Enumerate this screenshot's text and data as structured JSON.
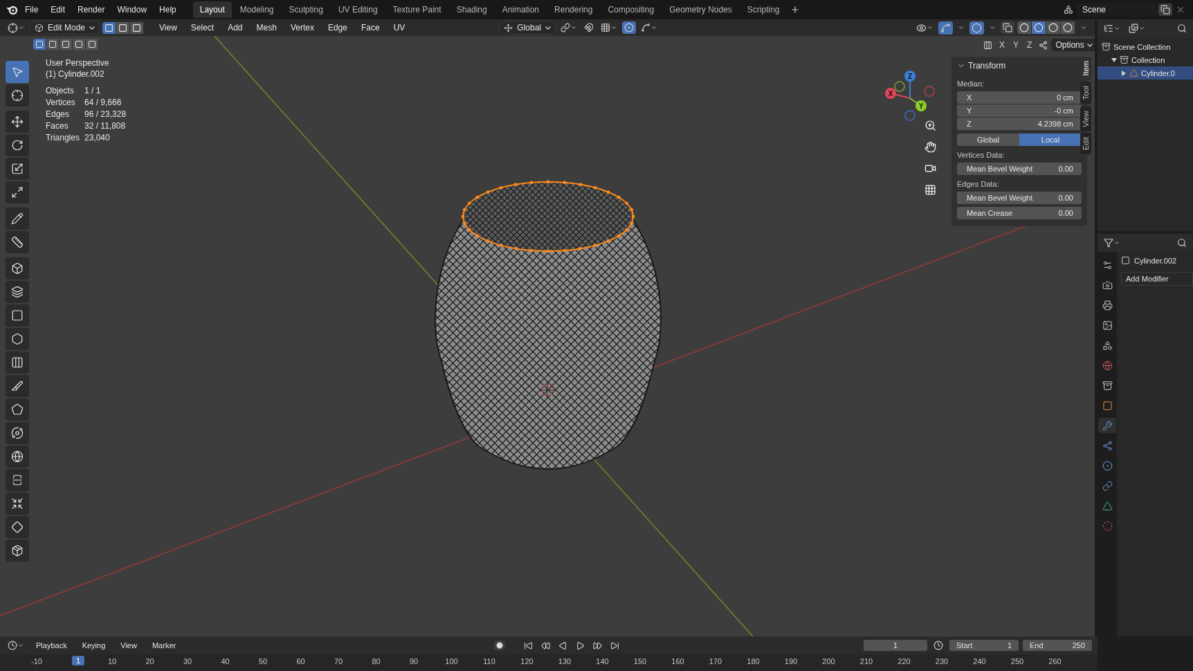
{
  "top_bar": {
    "menus": [
      "File",
      "Edit",
      "Render",
      "Window",
      "Help"
    ],
    "workspaces": [
      {
        "label": "Layout",
        "selected": true
      },
      {
        "label": "Modeling",
        "selected": false
      },
      {
        "label": "Sculpting",
        "selected": false
      },
      {
        "label": "UV Editing",
        "selected": false
      },
      {
        "label": "Texture Paint",
        "selected": false
      },
      {
        "label": "Shading",
        "selected": false
      },
      {
        "label": "Animation",
        "selected": false
      },
      {
        "label": "Rendering",
        "selected": false
      },
      {
        "label": "Compositing",
        "selected": false
      },
      {
        "label": "Geometry Nodes",
        "selected": false
      },
      {
        "label": "Scripting",
        "selected": false
      }
    ],
    "scene": "Scene"
  },
  "viewport_header": {
    "mode": "Edit Mode",
    "select_modes": [
      {
        "selected": true
      },
      {
        "selected": false
      },
      {
        "selected": false
      }
    ],
    "menus": [
      "View",
      "Select",
      "Add",
      "Mesh",
      "Vertex",
      "Edge",
      "Face",
      "UV"
    ],
    "orientation": "Global",
    "proportional_editing": true,
    "shading_modes": [
      {
        "selected": false
      },
      {
        "selected": true
      },
      {
        "selected": false
      },
      {
        "selected": false
      }
    ]
  },
  "viewport": {
    "box_modes": [
      {
        "selected": true
      },
      {
        "selected": false
      },
      {
        "selected": false
      },
      {
        "selected": false
      },
      {
        "selected": false
      }
    ],
    "mirror_axes": [
      "X",
      "Y",
      "Z"
    ],
    "options": "Options",
    "view_name": "User Perspective",
    "object_name": "(1) Cylinder.002",
    "stats": [
      {
        "label": "Objects",
        "value": "1 / 1"
      },
      {
        "label": "Vertices",
        "value": "64 / 9,666"
      },
      {
        "label": "Edges",
        "value": "96 / 23,328"
      },
      {
        "label": "Faces",
        "value": "32 / 11,808"
      },
      {
        "label": "Triangles",
        "value": "23,040"
      }
    ],
    "gizmo_labels": [
      "Z",
      "X",
      "Y"
    ],
    "tools": [
      {
        "selected": true
      },
      {
        "selected": false
      },
      {
        "selected": false
      },
      {
        "selected": false
      },
      {
        "selected": false
      },
      {
        "selected": false
      },
      {
        "selected": false
      },
      {
        "selected": false
      },
      {
        "selected": false
      },
      {
        "selected": false
      },
      {
        "selected": false
      },
      {
        "selected": false
      },
      {
        "selected": false
      },
      {
        "selected": false
      },
      {
        "selected": false
      },
      {
        "selected": false
      },
      {
        "selected": false
      },
      {
        "selected": false
      },
      {
        "selected": false
      },
      {
        "selected": false
      },
      {
        "selected": false
      }
    ]
  },
  "transform_panel": {
    "title": "Transform",
    "median_label": "Median:",
    "fields": [
      {
        "label": "X",
        "value": "0 cm"
      },
      {
        "label": "Y",
        "value": "-0 cm"
      },
      {
        "label": "Z",
        "value": "4.2398 cm"
      }
    ],
    "space": [
      {
        "label": "Global",
        "selected": false
      },
      {
        "label": "Local",
        "selected": true
      }
    ],
    "vertices_label": "Vertices Data:",
    "vertex_fields": [
      {
        "label": "Mean Bevel Weight",
        "value": "0.00"
      }
    ],
    "edges_label": "Edges Data:",
    "edge_fields": [
      {
        "label": "Mean Bevel Weight",
        "value": "0.00"
      },
      {
        "label": "Mean Crease",
        "value": "0.00"
      }
    ]
  },
  "sidebar_tabs": [
    {
      "label": "Item",
      "selected": true
    },
    {
      "label": "Tool",
      "selected": false
    },
    {
      "label": "View",
      "selected": false
    },
    {
      "label": "Edit",
      "selected": false
    }
  ],
  "outliner": {
    "items": [
      {
        "label": "Scene Collection",
        "selected": false,
        "children": [
          {
            "label": "Collection",
            "selected": false,
            "expanded": true,
            "children": [
              {
                "label": "Cylinder.0",
                "selected": true,
                "expanded": false
              }
            ]
          }
        ]
      }
    ]
  },
  "properties": {
    "object_name": "Cylinder.002",
    "add_modifier": "Add Modifier",
    "tabs": [
      {
        "selected": false
      },
      {
        "selected": false
      },
      {
        "selected": false
      },
      {
        "selected": false
      },
      {
        "selected": false
      },
      {
        "selected": false
      },
      {
        "selected": false
      },
      {
        "selected": false
      },
      {
        "selected": true
      },
      {
        "selected": false
      },
      {
        "selected": false
      },
      {
        "selected": false
      },
      {
        "selected": false
      },
      {
        "selected": false
      }
    ]
  },
  "timeline": {
    "menus": [
      "Playback",
      "Keying",
      "View",
      "Marker"
    ],
    "current_frame": "1",
    "ruler_current": "1",
    "start_label": "Start",
    "start": "1",
    "end_label": "End",
    "end": "250",
    "ruler": [
      "-10",
      "10",
      "20",
      "30",
      "40",
      "50",
      "60",
      "70",
      "80",
      "90",
      "100",
      "110",
      "120",
      "130",
      "140",
      "150",
      "160",
      "170",
      "180",
      "190",
      "200",
      "210",
      "220",
      "230",
      "240",
      "250",
      "260"
    ]
  }
}
